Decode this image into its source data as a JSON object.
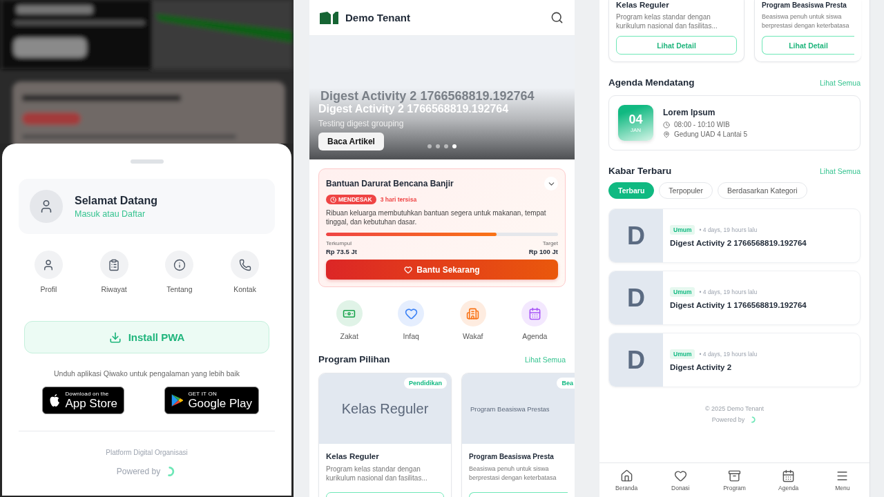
{
  "drawer": {
    "user_card": {
      "title": "Selamat Datang",
      "subtitle": "Masuk atau Daftar"
    },
    "menu": [
      {
        "label": "Profil",
        "kind": "user"
      },
      {
        "label": "Riwayat",
        "kind": "clipboard"
      },
      {
        "label": "Tentang",
        "kind": "info"
      },
      {
        "label": "Kontak",
        "kind": "phone"
      }
    ],
    "install_button": "Install PWA",
    "app_prompt": "Unduh aplikasi Qiwako untuk pengalaman yang lebih baik",
    "store_badges": [
      {
        "kind": "apple",
        "small": "Download on the",
        "large": "App Store"
      },
      {
        "kind": "google",
        "small": "GET IT ON",
        "large": "Google Play"
      }
    ],
    "tagline": "Platform Digital Organisasi",
    "powered_by": "Powered by"
  },
  "home": {
    "header": {
      "title": "Demo Tenant"
    },
    "hero": {
      "ghost_title": "Digest Activity 2 1766568819.192764",
      "title": "Digest Activity 2 1766568819.192764",
      "subtitle": "Testing digest grouping",
      "button": "Baca Artikel",
      "dots": [
        {
          "selected": false
        },
        {
          "selected": false
        },
        {
          "selected": false
        },
        {
          "selected": true
        }
      ]
    },
    "urgent": {
      "title": "Bantuan Darurat Bencana Banjir",
      "badge": "MENDESAK",
      "remaining": "3 hari tersisa",
      "description": "Ribuan keluarga membutuhkan bantuan segera untuk makanan, tempat tinggal, dan kebutuhan dasar.",
      "level": 0.735,
      "collected_label": "Terkumpul",
      "collected": "Rp 73.5 Jt",
      "target_label": "Target",
      "target": "Rp 100 Jt",
      "button": "Bantu Sekarang"
    },
    "quick_menu": [
      {
        "label": "Zakat",
        "kind": "money",
        "color": "#16a34a"
      },
      {
        "label": "Infaq",
        "kind": "heart",
        "color": "#3b82f6"
      },
      {
        "label": "Wakaf",
        "kind": "building",
        "color": "#f97316"
      },
      {
        "label": "Agenda",
        "kind": "calendar",
        "color": "#a855f7"
      }
    ],
    "programs": {
      "title": "Program Pilihan",
      "link": "Lihat Semua",
      "cards": [
        {
          "category": "Pendidikan",
          "image_text": "Kelas Reguler",
          "title": "Kelas Reguler",
          "description_lines": [
            "Program kelas standar dengan",
            "kurikulum nasional dan fasilitas..."
          ]
        },
        {
          "category": "Bea",
          "image_text": "Program Beasiswa Prestas",
          "title": "Program Beasiswa Presta",
          "description_lines": [
            "Beasiswa penuh untuk siswa",
            "berprestasi dengan keterbatasa"
          ]
        }
      ]
    }
  },
  "home_scrolled": {
    "program_cards": [
      {
        "title": "Kelas Reguler",
        "description_lines": [
          "Program kelas standar dengan",
          "kurikulum nasional dan fasilitas..."
        ],
        "button": "Lihat Detail"
      },
      {
        "title": "Program Beasiswa Presta",
        "description_lines": [
          "Beasiswa penuh untuk siswa",
          "berprestasi dengan keterbatasa"
        ],
        "button": "Lihat Detail"
      }
    ],
    "agenda": {
      "title": "Agenda Mendatang",
      "link": "Lihat Semua",
      "events": [
        {
          "day": "04",
          "month": "JAN",
          "title": "Lorem Ipsum",
          "time": "08:00 - 10:10 WIB",
          "location": "Gedung UAD 4 Lantai 5"
        }
      ]
    },
    "news": {
      "title": "Kabar Terbaru",
      "link": "Lihat Semua",
      "tabs": [
        {
          "label": "Terbaru",
          "selected": true
        },
        {
          "label": "Terpopuler",
          "selected": false
        },
        {
          "label": "Berdasarkan Kategori",
          "selected": false
        }
      ],
      "items": [
        {
          "initial": "D",
          "category": "Umum",
          "time": "• 4 days, 19 hours lalu",
          "title": "Digest Activity 2 1766568819.192764"
        },
        {
          "initial": "D",
          "category": "Umum",
          "time": "• 4 days, 19 hours lalu",
          "title": "Digest Activity 1 1766568819.192764"
        },
        {
          "initial": "D",
          "category": "Umum",
          "time": "• 4 days, 19 hours lalu",
          "title": "Digest Activity 2"
        }
      ]
    },
    "footer": {
      "copyright": "© 2025 Demo Tenant",
      "powered_by": "Powered by"
    },
    "bottom_nav": [
      {
        "label": "Beranda",
        "kind": "home"
      },
      {
        "label": "Donasi",
        "kind": "heart"
      },
      {
        "label": "Program",
        "kind": "box"
      },
      {
        "label": "Agenda",
        "kind": "calendar"
      },
      {
        "label": "Menu",
        "kind": "menu"
      }
    ]
  }
}
